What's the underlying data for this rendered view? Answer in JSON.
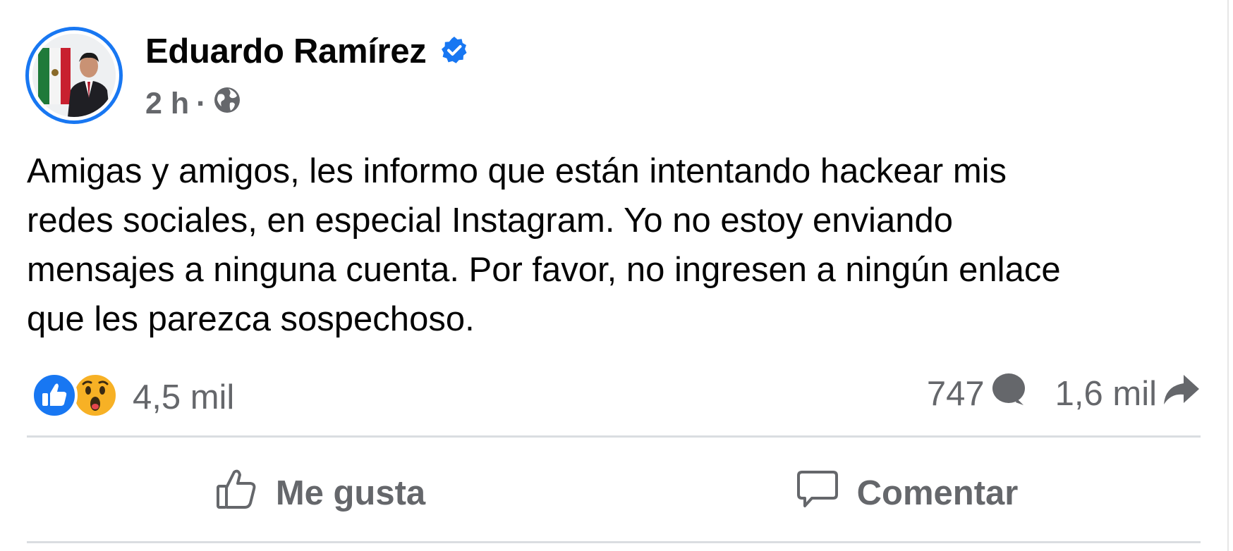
{
  "post": {
    "author": {
      "name": "Eduardo Ramírez",
      "verified": true,
      "avatar_icon": "profile-photo"
    },
    "time": "2 h",
    "separator": "·",
    "privacy_icon": "globe-icon",
    "text": "Amigas y amigos, les informo que están intentando hackear mis\nredes sociales, en especial Instagram. Yo no estoy enviando\nmensajes a ninguna cuenta. Por favor, no ingresen a ningún enlace\nque les parezca sospechoso."
  },
  "stats": {
    "reactions": [
      "like-icon",
      "wow-icon"
    ],
    "reaction_count": "4,5 mil",
    "comments_count": "747",
    "shares_count": "1,6 mil"
  },
  "actions": {
    "like_label": "Me gusta",
    "comment_label": "Comentar"
  },
  "colors": {
    "accent": "#1877f2",
    "secondary_text": "#65676b",
    "divider": "#dadde1",
    "wow": "#f7b125"
  }
}
